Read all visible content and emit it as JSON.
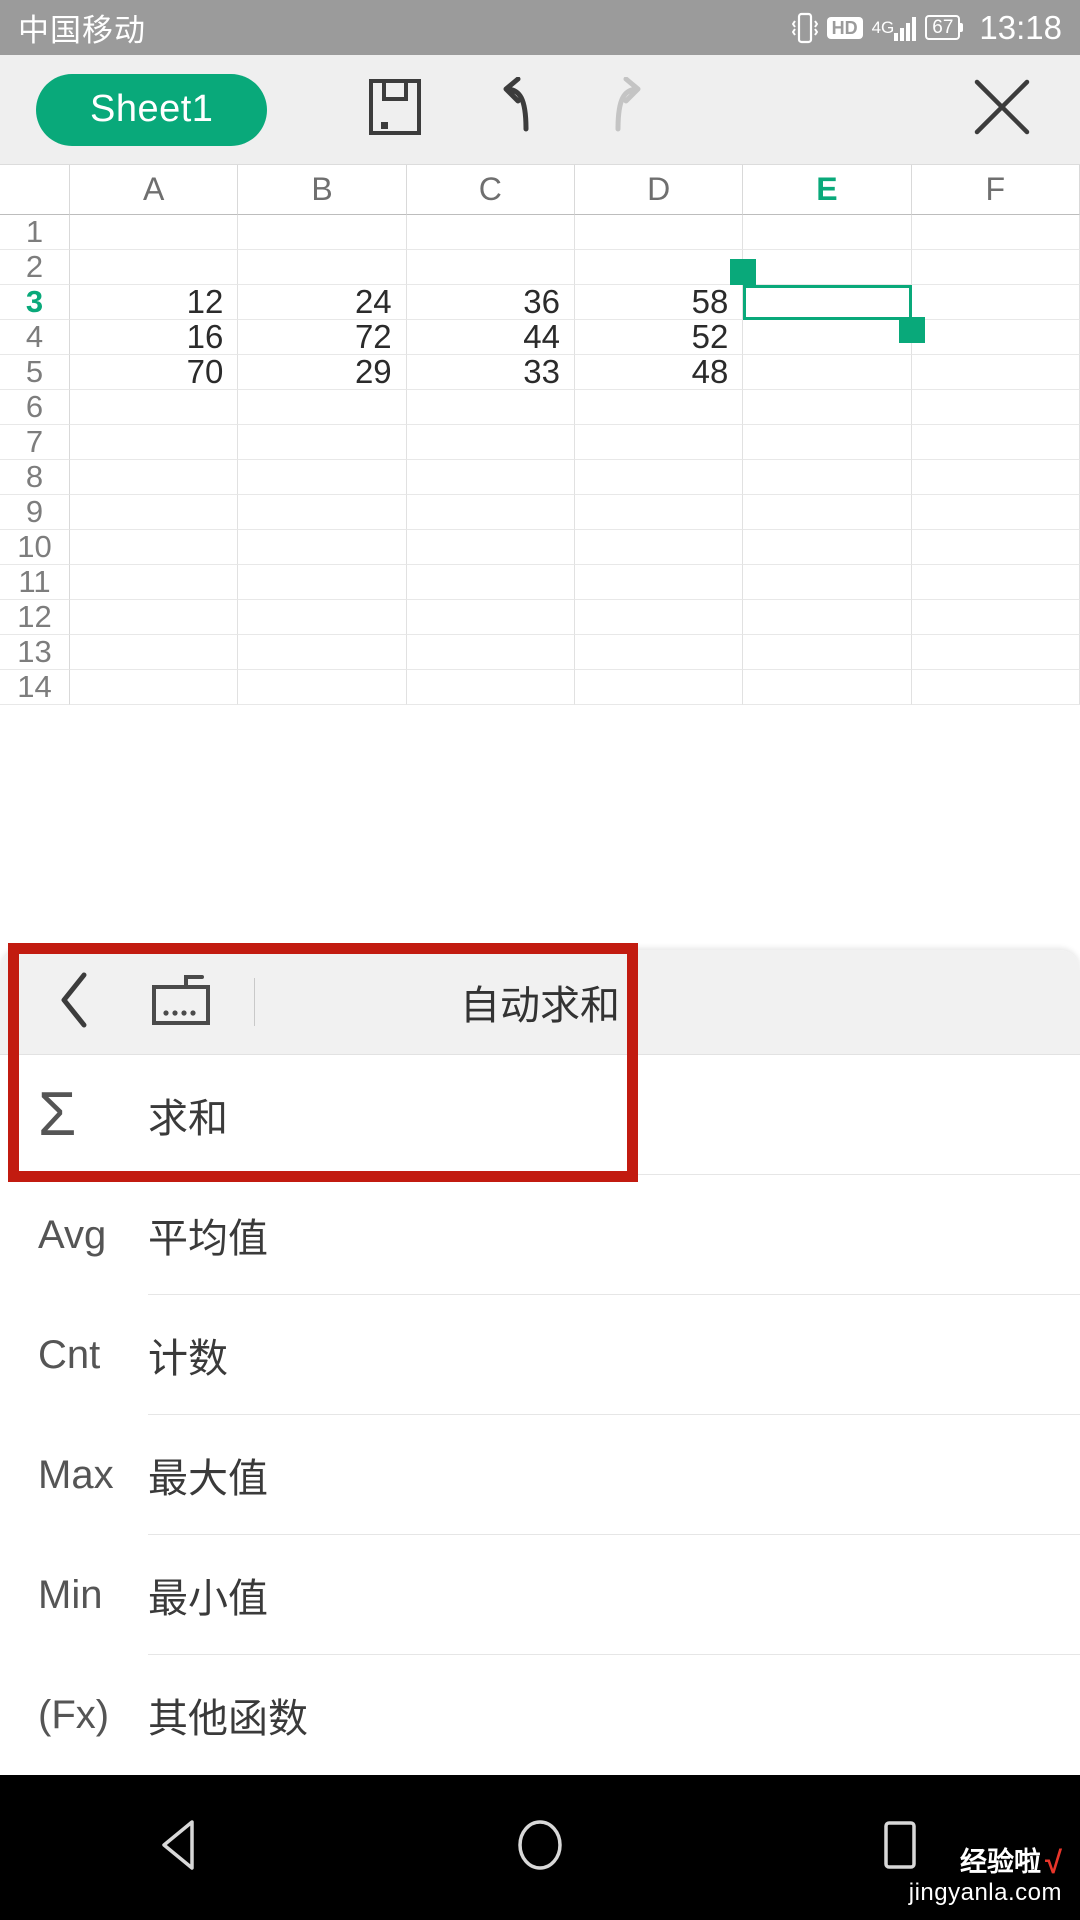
{
  "status_bar": {
    "carrier": "中国移动",
    "hd_label": "HD",
    "network": "4G",
    "battery": "67",
    "time": "13:18",
    "vibrate_icon": "vibrate-icon",
    "signal_icon": "signal-bars-icon",
    "battery_icon": "battery-icon"
  },
  "toolbar": {
    "sheet_name": "Sheet1",
    "save_icon": "save-floppy-icon",
    "undo_icon": "undo-arrow-icon",
    "redo_icon": "redo-arrow-icon",
    "close_icon": "close-x-icon"
  },
  "spreadsheet": {
    "columns": [
      "A",
      "B",
      "C",
      "D",
      "E",
      "F"
    ],
    "selected_column": "E",
    "selected_row": "3",
    "selected_cell": "E3",
    "rows": [
      {
        "num": "1",
        "cells": [
          "",
          "",
          "",
          "",
          "",
          ""
        ]
      },
      {
        "num": "2",
        "cells": [
          "",
          "",
          "",
          "",
          "",
          ""
        ]
      },
      {
        "num": "3",
        "cells": [
          "12",
          "24",
          "36",
          "58",
          "",
          ""
        ]
      },
      {
        "num": "4",
        "cells": [
          "16",
          "72",
          "44",
          "52",
          "",
          ""
        ]
      },
      {
        "num": "5",
        "cells": [
          "70",
          "29",
          "33",
          "48",
          "",
          ""
        ]
      },
      {
        "num": "6",
        "cells": [
          "",
          "",
          "",
          "",
          "",
          ""
        ]
      },
      {
        "num": "7",
        "cells": [
          "",
          "",
          "",
          "",
          "",
          ""
        ]
      },
      {
        "num": "8",
        "cells": [
          "",
          "",
          "",
          "",
          "",
          ""
        ]
      },
      {
        "num": "9",
        "cells": [
          "",
          "",
          "",
          "",
          "",
          ""
        ]
      },
      {
        "num": "10",
        "cells": [
          "",
          "",
          "",
          "",
          "",
          ""
        ]
      },
      {
        "num": "11",
        "cells": [
          "",
          "",
          "",
          "",
          "",
          ""
        ]
      },
      {
        "num": "12",
        "cells": [
          "",
          "",
          "",
          "",
          "",
          ""
        ]
      },
      {
        "num": "13",
        "cells": [
          "",
          "",
          "",
          "",
          "",
          ""
        ]
      },
      {
        "num": "14",
        "cells": [
          "",
          "",
          "",
          "",
          "",
          ""
        ]
      }
    ]
  },
  "panel": {
    "title": "自动求和",
    "back_icon": "back-chevron-icon",
    "keyboard_icon": "hide-keyboard-icon",
    "items": [
      {
        "icon_text": "Σ",
        "icon_name": "sigma-icon",
        "label": "求和"
      },
      {
        "icon_text": "Avg",
        "icon_name": "average-icon",
        "label": "平均值"
      },
      {
        "icon_text": "Cnt",
        "icon_name": "count-icon",
        "label": "计数"
      },
      {
        "icon_text": "Max",
        "icon_name": "max-icon",
        "label": "最大值"
      },
      {
        "icon_text": "Min",
        "icon_name": "min-icon",
        "label": "最小值"
      },
      {
        "icon_text": "(Fx)",
        "icon_name": "function-icon",
        "label": "其他函数"
      }
    ]
  },
  "nav_bar": {
    "back_icon": "nav-back-triangle-icon",
    "home_icon": "nav-home-circle-icon",
    "recents_icon": "nav-recents-square-icon"
  },
  "watermark": {
    "brand": "经验啦",
    "check": "√",
    "site": "jingyanla.com"
  },
  "colors": {
    "accent_green": "#09a97a",
    "annotation_red": "#c21b10",
    "status_gray": "#9b9b9b",
    "toolbar_gray": "#efefef"
  }
}
